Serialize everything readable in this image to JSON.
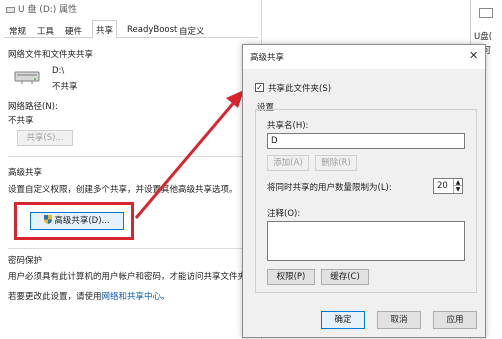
{
  "props_window": {
    "title": "U 盘 (D:) 属性",
    "tabs": [
      "常规",
      "工具",
      "硬件",
      "共享",
      "ReadyBoost",
      "自定义"
    ],
    "active_tab": "共享",
    "network_sharing": {
      "heading": "网络文件和文件夹共享",
      "drive_name": "D:\\",
      "drive_status": "不共享",
      "network_path_label": "网络路径(N):",
      "network_path_value": "不共享",
      "share_button": "共享(S)..."
    },
    "advanced": {
      "heading": "高级共享",
      "description": "设置自定义权限，创建多个共享，并设置其他高级共享选项。",
      "button": "高级共享(D)..."
    },
    "password": {
      "heading": "密码保护",
      "line1": "用户必须具有此计算机的用户帐户和密码，才能访问共享文件夹。",
      "line2_prefix": "若要更改此设置，请使用",
      "line2_link": "网络和共享中心",
      "line2_suffix": "。"
    }
  },
  "right_window": {
    "label": "U盘(",
    "label2": "高可"
  },
  "dialog": {
    "title": "高级共享",
    "close_label": "✕",
    "share_checkbox_label": "共享此文件夹(S)",
    "share_checked": true,
    "settings_label": "设置",
    "share_name_label": "共享名(H):",
    "share_name_value": "D",
    "add_button": "添加(A)",
    "delete_button": "删除(R)",
    "limit_label": "将同时共享的用户数量限制为(L):",
    "limit_value": "20",
    "comment_label": "注释(O):",
    "permissions_button": "权限(P)",
    "cache_button": "缓存(C)",
    "ok_button": "确定",
    "cancel_button": "取消",
    "apply_button": "应用"
  },
  "colors": {
    "highlight_red": "#d9262e",
    "arrow_red": "#d9262e",
    "link_blue": "#0a58b6"
  }
}
